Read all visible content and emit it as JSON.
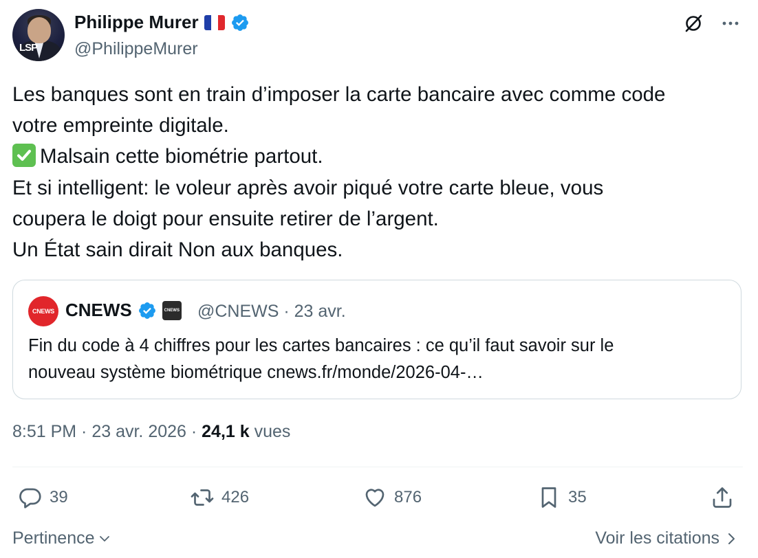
{
  "author": {
    "name": "Philippe Murer",
    "handle": "@PhilippeMurer",
    "avatar_logo": "LSP",
    "flag": "france-flag",
    "badge": "verified-badge-icon"
  },
  "post": {
    "lines": [
      "Les banques sont en train d’imposer la carte bancaire avec comme code",
      "votre empreinte digitale.",
      "Malsain cette biométrie partout.",
      "Et si intelligent: le voleur après avoir piqué votre carte bleue, vous",
      "coupera le doigt pour ensuite retirer de l’argent.",
      "Un État sain dirait Non aux banques."
    ],
    "check_emoji": "check-mark-emoji"
  },
  "quote": {
    "avatar_text": "CNEWS",
    "name": "CNEWS",
    "badge2_text": "CNEWS",
    "handle_date": "@CNEWS · 23 avr.",
    "lines": [
      "Fin du code à 4 chiffres pour les cartes bancaires : ce qu’il faut savoir sur le",
      "nouveau système biométrique cnews.fr/monde/2026-04-…"
    ]
  },
  "meta": {
    "time_date": "8:51 PM · 23 avr. 2026 · ",
    "views_count": "24,1 k",
    "views_label": "vues"
  },
  "actions": {
    "replies": "39",
    "reposts": "426",
    "likes": "876",
    "bookmarks": "35"
  },
  "footer": {
    "sort_label": "Pertinence",
    "quotes_label": "Voir les citations"
  },
  "colors": {
    "verified": "#1d9bf0",
    "cnews_red": "#e1262b",
    "secondary_text": "#536471",
    "check_green": "#5ec051"
  }
}
